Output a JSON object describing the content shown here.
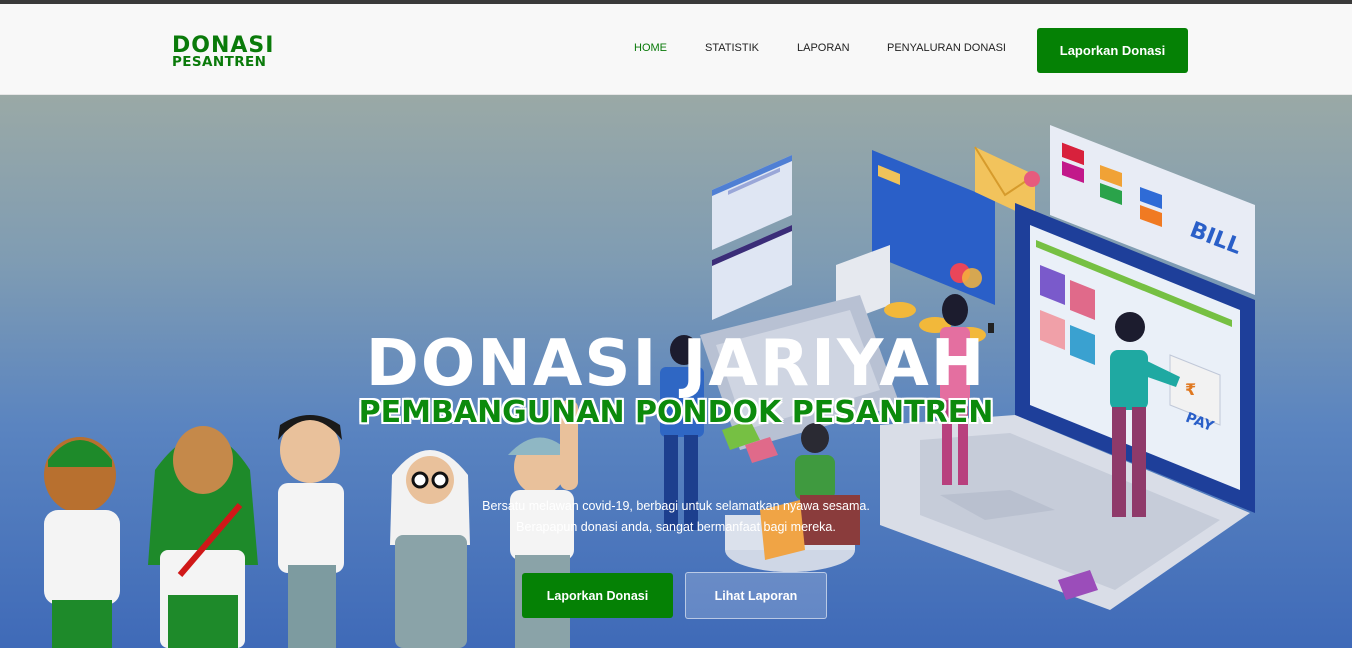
{
  "brand": {
    "line1": "DONASI",
    "line2": "PESANTREN"
  },
  "nav": {
    "items": [
      {
        "label": "HOME",
        "active": true
      },
      {
        "label": "STATISTIK",
        "active": false
      },
      {
        "label": "LAPORAN",
        "active": false
      },
      {
        "label": "PENYALURAN DONASI",
        "active": false
      }
    ],
    "cta_label": "Laporkan Donasi"
  },
  "hero": {
    "title": "DONASI JARIYAH",
    "subtitle": "PEMBANGUNAN PONDOK PESANTREN",
    "description_line1": "Bersatu melawan covid-19, berbagi untuk selamatkan nyawa sesama.",
    "description_line2": "Berapapun donasi anda, sangat bermanfaat bagi mereka.",
    "primary_button": "Laporkan Donasi",
    "secondary_button": "Lihat Laporan",
    "illustration_text": {
      "bill": "BILL",
      "pay": "PAY",
      "currency": "₹"
    }
  },
  "colors": {
    "brand_green": "#058105",
    "nav_active": "#0a7a0a",
    "hero_top": "#9aa9a6",
    "hero_bottom": "#3f6ab8"
  }
}
